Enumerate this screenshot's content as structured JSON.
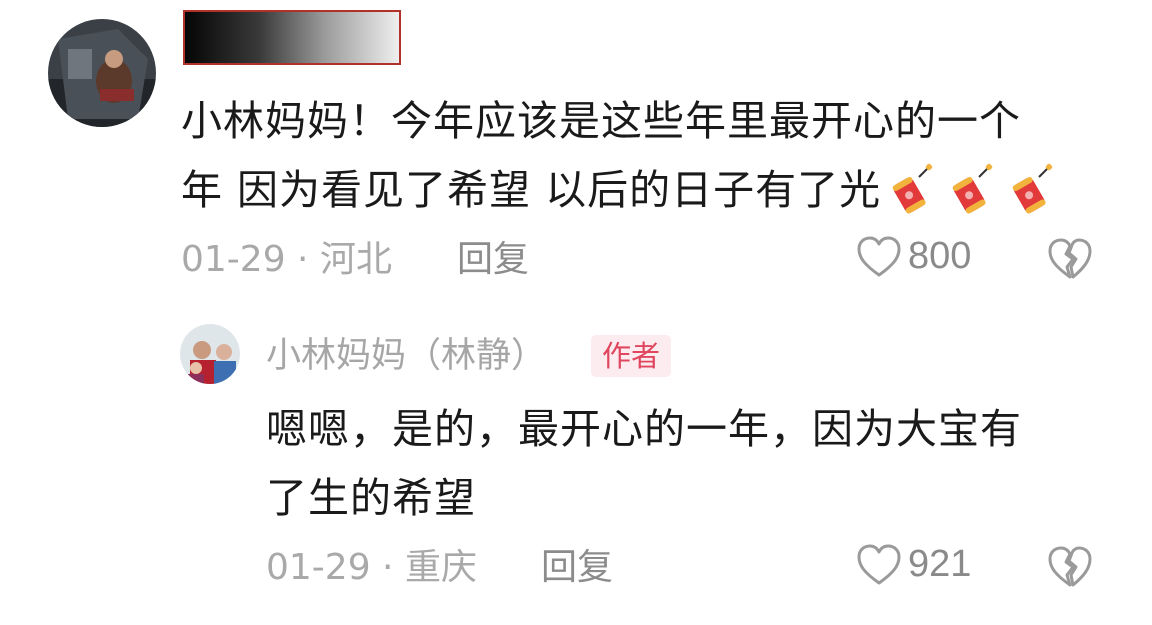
{
  "comment": {
    "text_line1": "小林妈妈！今年应该是这些年里最开心的一个",
    "text_line2": "年 因为看见了希望 以后的日子有了光",
    "emoji": "firecracker-emoji",
    "date_location": "01-29 · 河北",
    "reply_label": "回复",
    "like_count": "800"
  },
  "reply": {
    "author_name": "小林妈妈（林静）",
    "author_badge": "作者",
    "text_line1": "嗯嗯，是的，最开心的一年，因为大宝有",
    "text_line2": "了生的希望",
    "date_location": "01-29 · 重庆",
    "reply_label": "回复",
    "like_count": "921"
  },
  "icons": {
    "like": "heart-outline-icon",
    "dislike": "broken-heart-icon"
  },
  "colors": {
    "meta_gray": "#a9a9a9",
    "badge_bg": "#fdecef",
    "badge_text": "#e0475f",
    "redaction_border": "#b0322a"
  }
}
